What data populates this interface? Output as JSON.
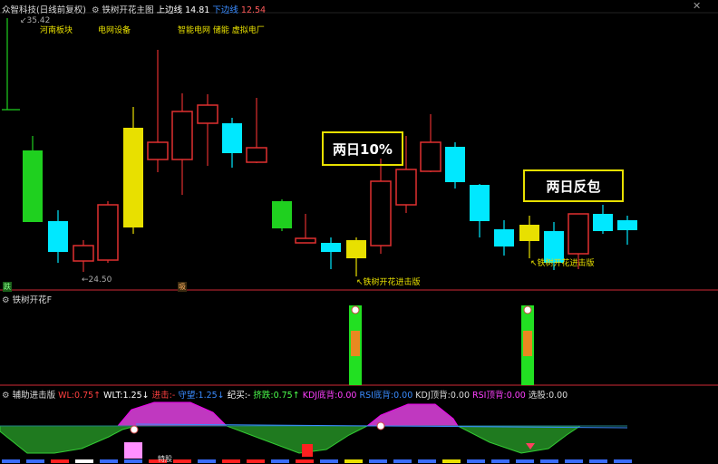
{
  "colors": {
    "up": "#e03030",
    "down": "#00e8ff",
    "yellow": "#e8e000",
    "green": "#1fd01f",
    "divider": "#8a1c24"
  },
  "main": {
    "stock_title": "众智科技(日线前复权)",
    "indicator_name": "铁树开花主图",
    "upper_label": "上边线",
    "upper_value": "14.81",
    "lower_label": "下边线",
    "lower_value": "12.54",
    "high_mark": "35.42",
    "low_mark": "24.50",
    "tags": [
      "河南板块",
      "电网设备",
      "智能电网 储能 虚拟电厂"
    ],
    "box1": "两日10%",
    "box2": "两日反包",
    "ann1": "↖铁树开花进击版",
    "ann2": "↖铁树开花进击版",
    "badge_fall": "跌",
    "badge_mid": "吸"
  },
  "panel2": {
    "title": "铁树开花F"
  },
  "panel3": {
    "title": "辅助进击版",
    "wl_label": "WL:",
    "wl_value": "0.75↑",
    "wlt_label": "WLT:",
    "wlt_value": "1.25↓",
    "jinjin_label": "进击:",
    "jinjin_value": "-",
    "shouwang_label": "守望:",
    "shouwang_value": "1.25↓",
    "jixiao_label": "纪买:",
    "jixiao_value": "-",
    "jidie_label": "挤跌:",
    "jidie_value": "0.75↑",
    "kdj_di_label": "KDJ底背:",
    "kdj_di_value": "0.00",
    "rsi_di_label": "RSI底背:",
    "rsi_di_value": "0.00",
    "kdj_ding_label": "KDJ顶背:",
    "kdj_ding_value": "0.00",
    "rsi_ding_label": "RSI顶背:",
    "rsi_ding_value": "0.00",
    "xuangu_label": "选股:",
    "xuangu_value": "0.00",
    "bottom_tag": "特股"
  }
}
